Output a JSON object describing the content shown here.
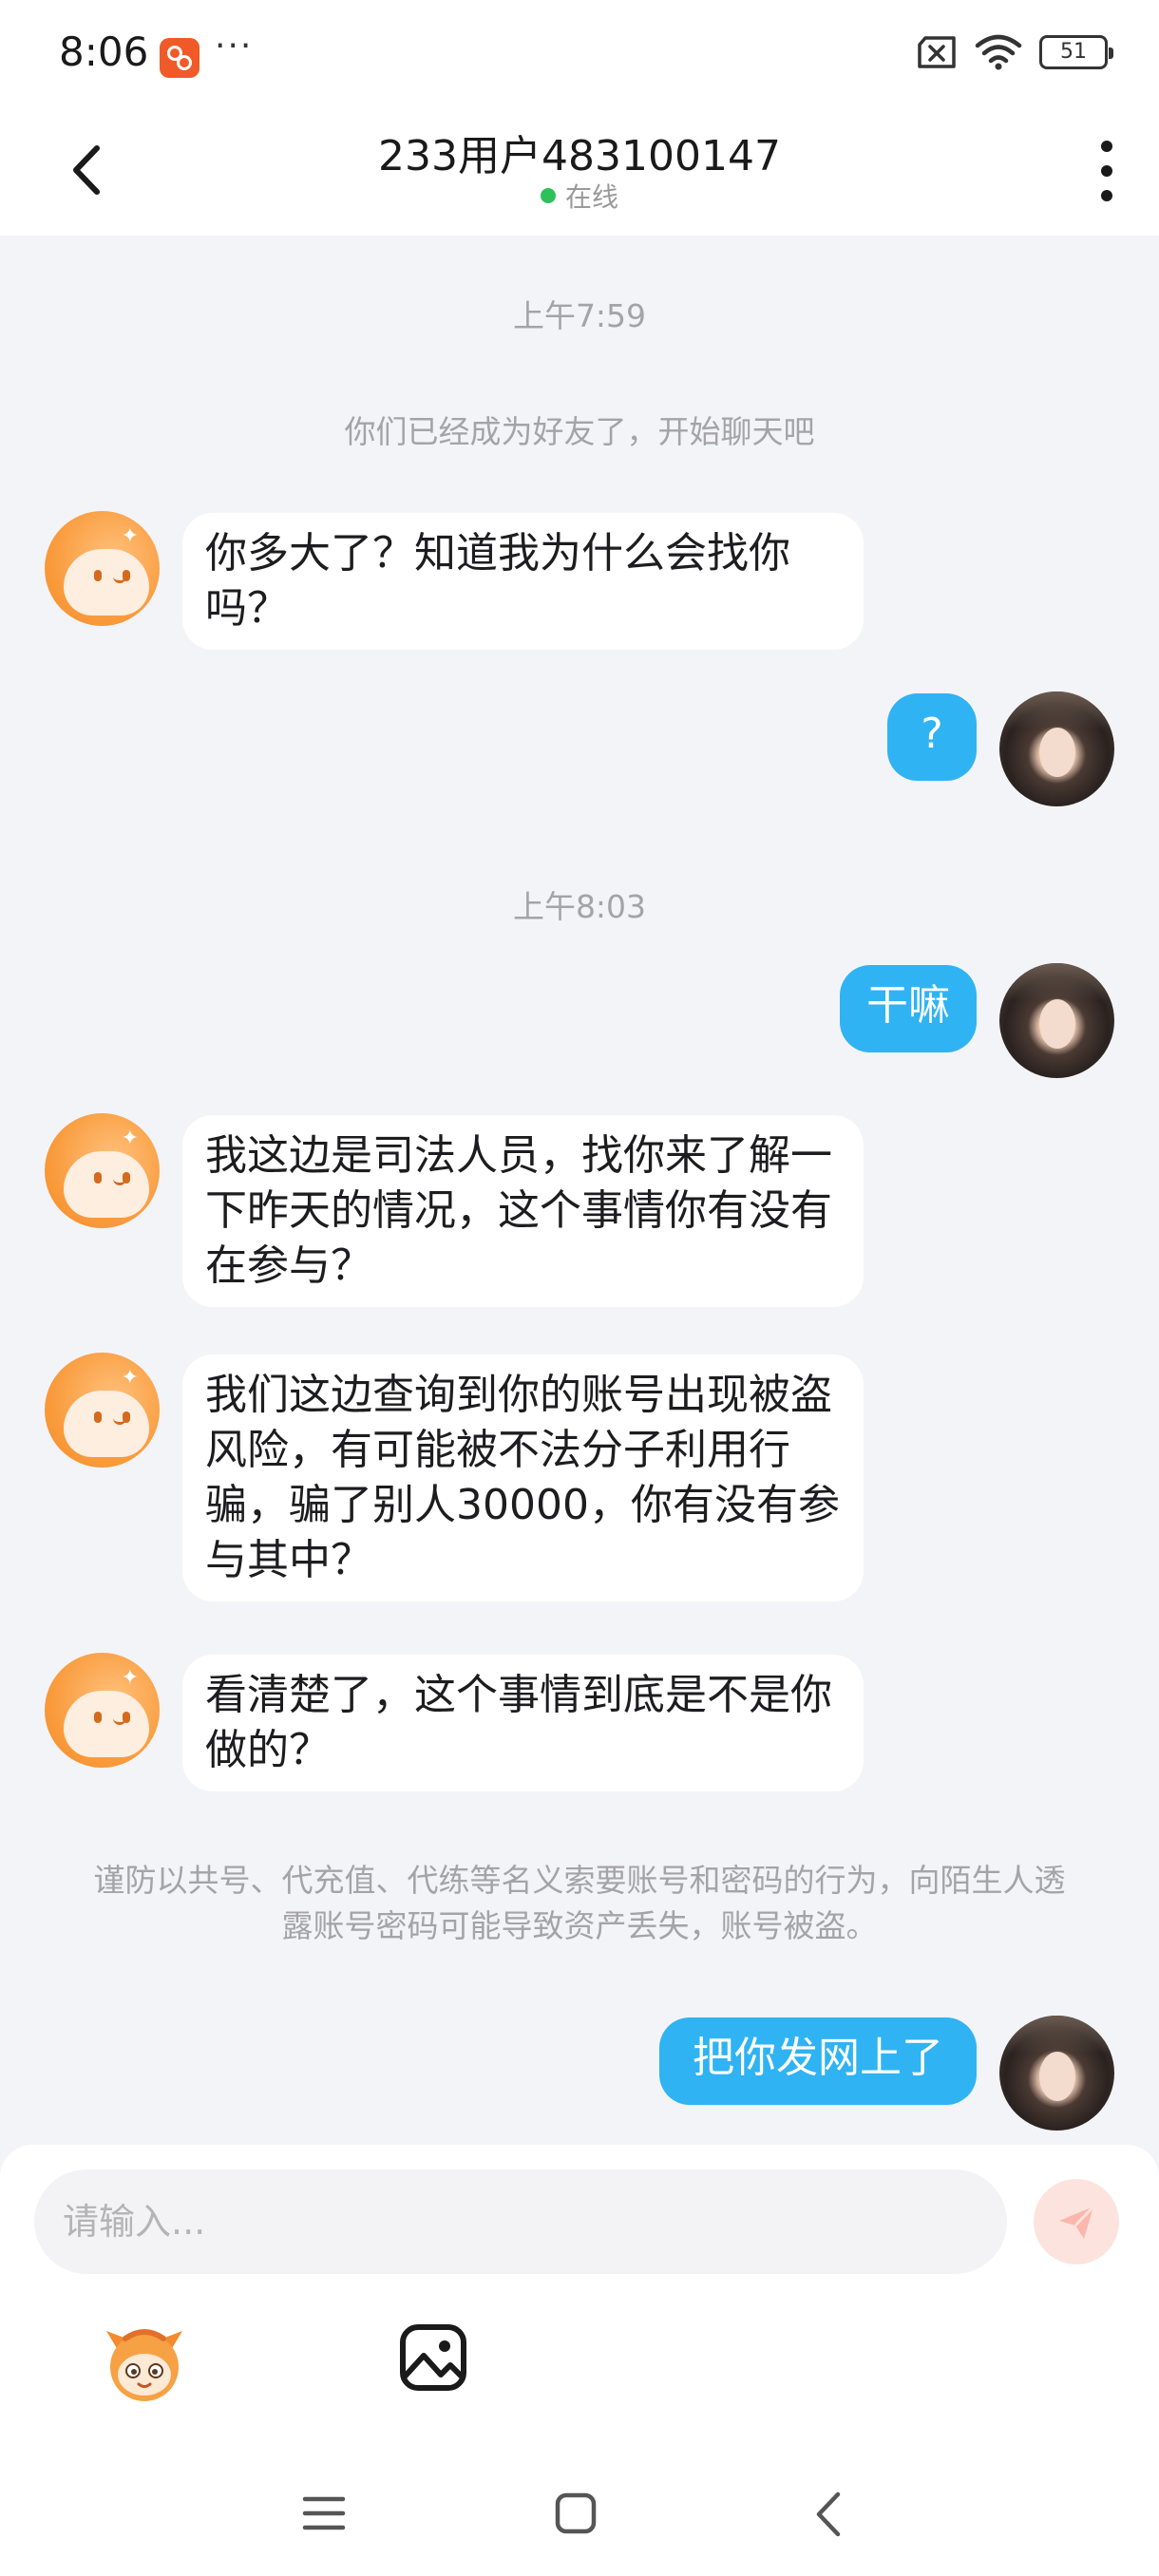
{
  "status_bar": {
    "time": "8:06",
    "more_dots": "···",
    "battery": "51"
  },
  "header": {
    "title": "233用户483100147",
    "status": "在线"
  },
  "chat": {
    "timestamp1": "上午7:59",
    "system_msg": "你们已经成为好友了，开始聊天吧",
    "timestamp2": "上午8:03",
    "safety_notice": "谨防以共号、代充值、代练等名义索要账号和密码的行为，向陌生人透露账号密码可能导致资产丢失，账号被盗。",
    "messages": [
      {
        "from": "other",
        "text": "你多大了？知道我为什么会找你吗？"
      },
      {
        "from": "me",
        "text": "?"
      },
      {
        "from": "me",
        "text": "干嘛"
      },
      {
        "from": "other",
        "text": "我这边是司法人员，找你来了解一下昨天的情况，这个事情你有没有在参与？"
      },
      {
        "from": "other",
        "text": "我们这边查询到你的账号出现被盗风险，有可能被不法分子利用行骗，骗了别人30000，你有没有参与其中？"
      },
      {
        "from": "other",
        "text": "看清楚了，这个事情到底是不是你做的？"
      },
      {
        "from": "me",
        "text": "把你发网上了"
      }
    ]
  },
  "input": {
    "placeholder": "请输入..."
  },
  "icons": {
    "back": "chevron-left-icon",
    "more": "more-vertical-icon",
    "send": "send-icon",
    "emoji": "emoji-icon",
    "image": "image-icon"
  },
  "colors": {
    "accent_blue": "#2fb3f3",
    "online_green": "#2ec05b",
    "page_bg": "#f3f4f8",
    "avatar_orange": "#f99a3b"
  }
}
